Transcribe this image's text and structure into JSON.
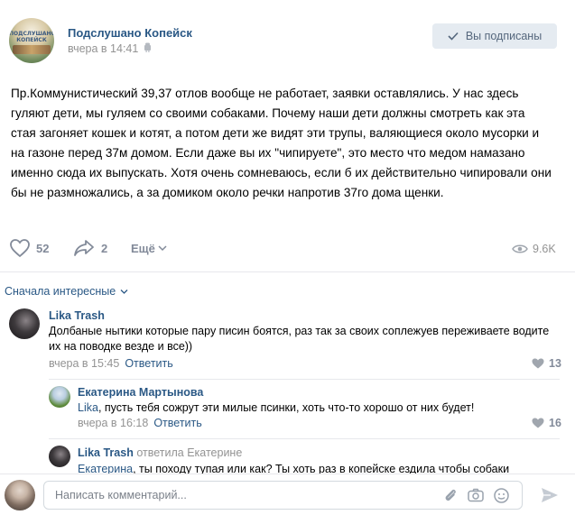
{
  "post": {
    "group_name": "Подслушано Копейск",
    "time": "вчера в 14:41",
    "subscribed_label": "Вы подписаны",
    "avatar_logo_text": "ПОДСЛУШАНО КОПЕЙСК",
    "text": "Пр.Коммунистический 39,37 отлов вообще не работает, заявки оставлялись. У нас здесь гуляют дети, мы гуляем со своими собаками. Почему наши дети должны смотреть как эта стая загоняет кошек и котят, а потом дети же видят эти трупы, валяющиеся около мусорки и на газоне перед 37м домом. Если даже вы их \"чипируете\", это место что медом намазано именно сюда их выпускать. Хотя очень сомневаюсь, если б их действительно чипировали они бы не размножались, а за домиком около речки напротив 37го дома щенки.",
    "likes": "52",
    "shares": "2",
    "more_label": "Ещё",
    "views": "9.6K"
  },
  "comments_section": {
    "sort_label": "Сначала интересные"
  },
  "comments": [
    {
      "author": "Lika Trash",
      "replied_to": "",
      "mention": "",
      "text": "Долбаные нытики которые пару писин боятся, раз так за своих соплежуев переживаете водите их на поводке везде и все))",
      "time": "вчера в 15:45",
      "reply_label": "Ответить",
      "likes": "13"
    },
    {
      "author": "Екатерина Мартынова",
      "replied_to": "",
      "mention": "Lika",
      "text": ", пусть тебя сожрут эти милые псинки, хоть что-то хорошо от них будет!",
      "time": "вчера в 16:18",
      "reply_label": "Ответить",
      "likes": "16"
    },
    {
      "author": "Lika Trash",
      "replied_to": "ответила Екатерине",
      "mention": "Екатерина",
      "text": ", ты походу тупая или как? Ты хоть раз в копейске ездила чтобы собаки"
    }
  ],
  "composer": {
    "placeholder": "Написать комментарий..."
  },
  "colors": {
    "link": "#2a5885",
    "muted": "#939393",
    "button_bg": "#e5ebf1",
    "divider": "#e7e8ec"
  },
  "icons": [
    "android-icon",
    "check-icon",
    "like-icon",
    "share-icon",
    "chevron-down-icon",
    "eye-icon",
    "heart-icon",
    "paperclip-icon",
    "camera-icon",
    "smile-icon",
    "send-icon"
  ]
}
